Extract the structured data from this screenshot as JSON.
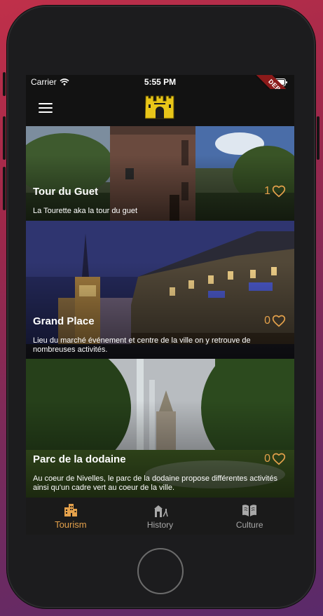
{
  "status_bar": {
    "carrier": "Carrier",
    "time": "5:55 PM",
    "wifi_icon": "wifi-icon",
    "battery_icon": "battery-icon"
  },
  "debug_banner": "DEBUG",
  "app_bar": {
    "menu_icon": "hamburger-menu-icon",
    "logo_icon": "castle-logo-icon",
    "logo_color": "#e8c619"
  },
  "cards": [
    {
      "title": "Tour du Guet",
      "description": "La Tourette aka la tour du guet",
      "likes": "1"
    },
    {
      "title": "Grand Place",
      "description": "Lieu du marché événement et centre de la ville on y retrouve de nombreuses activités.",
      "likes": "0"
    },
    {
      "title": "Parc de la dodaine",
      "description": "Au coeur de Nivelles, le parc de la dodaine propose différentes activités ainsi qu'un cadre vert au coeur de la ville.",
      "likes": "0"
    }
  ],
  "bottom_nav": [
    {
      "label": "Tourism",
      "icon": "city-buildings-icon",
      "active": true
    },
    {
      "label": "History",
      "icon": "monument-icon",
      "active": false
    },
    {
      "label": "Culture",
      "icon": "open-book-icon",
      "active": false
    }
  ],
  "colors": {
    "accent": "#e4a14b",
    "background": "#121212",
    "nav_background": "#1a1a1a",
    "inactive": "#a8a8a8"
  }
}
